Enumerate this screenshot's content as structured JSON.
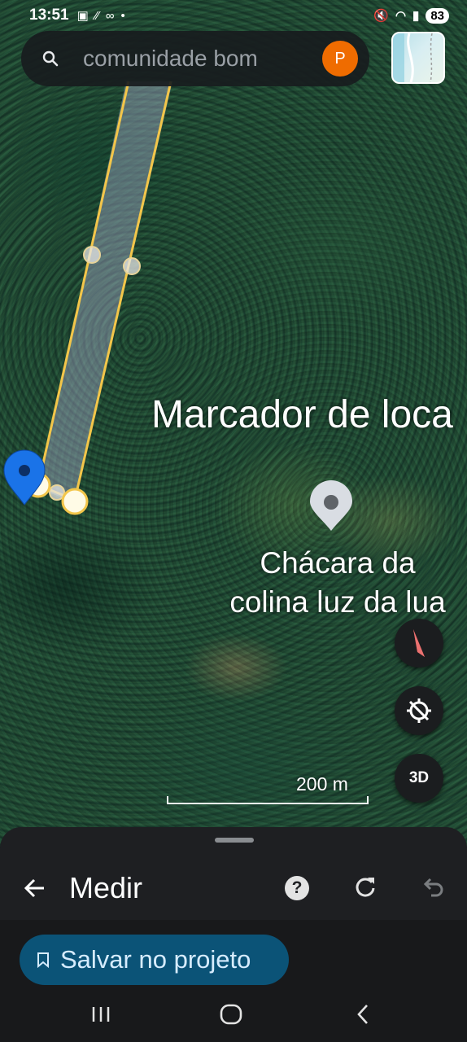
{
  "status_bar": {
    "time": "13:51",
    "battery": "83"
  },
  "search": {
    "placeholder": "comunidade bom",
    "avatar_letter": "P"
  },
  "map": {
    "marker_title": "Marcador de loca",
    "place_name_line1": "Chácara da",
    "place_name_line2": "colina luz da lua",
    "scale": "200 m",
    "btn_3d": "3D",
    "icons": [
      "search-icon",
      "compass-icon",
      "location-off-icon",
      "pin-icon",
      "place-marker-icon"
    ]
  },
  "sheet": {
    "title": "Medir",
    "help_label": "?",
    "save_label": "Salvar no projeto",
    "icons": [
      "back-arrow-icon",
      "help-icon",
      "redo-icon",
      "undo-icon",
      "bookmark-icon"
    ]
  },
  "nav": {
    "icons": [
      "recents-icon",
      "home-icon",
      "back-icon"
    ]
  },
  "colors": {
    "measure_line": "#f3c64a",
    "save_button": "#0b5377",
    "avatar": "#ef6c00",
    "pin": "#1a73e8"
  }
}
